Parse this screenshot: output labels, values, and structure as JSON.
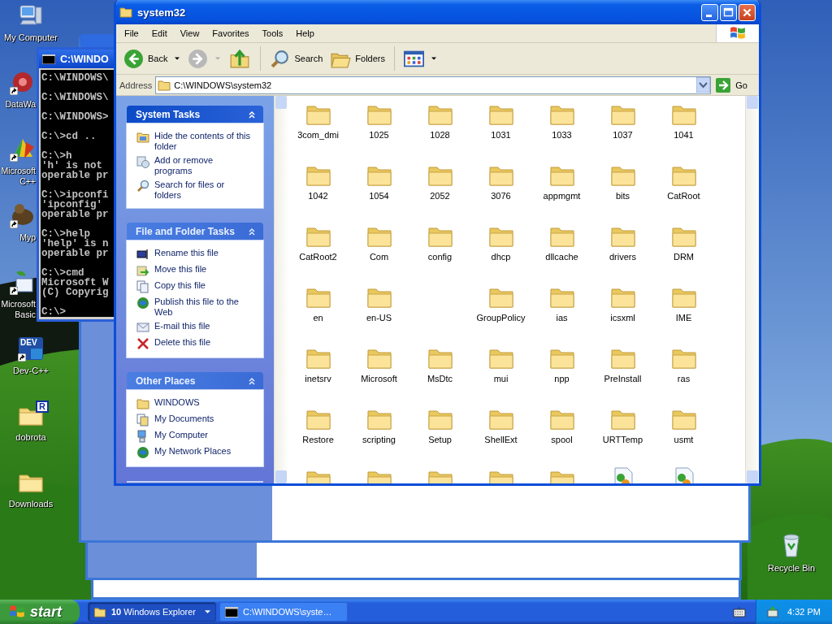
{
  "desktop": {
    "icons": [
      {
        "kind": "computer",
        "lines": [
          "My Computer"
        ],
        "shortcut": false
      },
      {
        "kind": "gear",
        "lines": [
          "DataWa"
        ],
        "shortcut": true
      },
      {
        "kind": "studio",
        "lines": [
          "Microsoft",
          "C++"
        ],
        "shortcut": true
      },
      {
        "kind": "creature",
        "lines": [
          "Myp"
        ],
        "shortcut": true
      },
      {
        "kind": "basic",
        "lines": [
          "Microsoft",
          "Basic"
        ],
        "shortcut": true
      },
      {
        "kind": "dev",
        "badge": "DEV",
        "lines": [
          "Dev-C++"
        ],
        "shortcut": true
      },
      {
        "kind": "folder",
        "badge": "R",
        "lines": [
          "dobrota"
        ],
        "shortcut": false
      },
      {
        "kind": "folder",
        "lines": [
          "Downloads"
        ],
        "shortcut": false
      }
    ],
    "recycle_bin": {
      "label": "Recycle Bin"
    }
  },
  "console_window": {
    "title": "C:\\WINDO",
    "blocks": [
      [
        "C:\\WINDOWS\\"
      ],
      [
        "C:\\WINDOWS\\"
      ],
      [
        "C:\\WINDOWS>"
      ],
      [
        "C:\\>cd .."
      ],
      [
        "C:\\>h",
        "'h' is not",
        "operable pr"
      ],
      [
        "C:\\>ipconfi",
        "'ipconfig'",
        "operable pr"
      ],
      [
        "C:\\>help",
        "'help' is n",
        "operable pr"
      ],
      [
        "C:\\>cmd",
        "Microsoft W",
        "(C) Copyrig"
      ],
      [
        "C:\\>"
      ]
    ]
  },
  "explorer": {
    "title": "system32",
    "menu": [
      "File",
      "Edit",
      "View",
      "Favorites",
      "Tools",
      "Help"
    ],
    "toolbar": {
      "back": "Back",
      "forward_disabled": true,
      "search": "Search",
      "folders": "Folders"
    },
    "address": {
      "label": "Address",
      "value": "C:\\WINDOWS\\system32",
      "go": "Go"
    },
    "task_panes": [
      {
        "title": "System Tasks",
        "special": true,
        "items": [
          {
            "kind": "hide",
            "label": "Hide the contents of this folder"
          },
          {
            "kind": "addremove",
            "label": "Add or remove programs"
          },
          {
            "kind": "search",
            "label": "Search for files or folders"
          }
        ]
      },
      {
        "title": "File and Folder Tasks",
        "special": false,
        "items": [
          {
            "kind": "rename",
            "label": "Rename this file"
          },
          {
            "kind": "move",
            "label": "Move this file"
          },
          {
            "kind": "copy",
            "label": "Copy this file"
          },
          {
            "kind": "publish",
            "label": "Publish this file to the Web"
          },
          {
            "kind": "email",
            "label": "E-mail this file"
          },
          {
            "kind": "delete",
            "label": "Delete this file"
          }
        ]
      },
      {
        "title": "Other Places",
        "special": false,
        "items": [
          {
            "kind": "folder",
            "label": "WINDOWS"
          },
          {
            "kind": "documents",
            "label": "My Documents"
          },
          {
            "kind": "computer",
            "label": "My Computer"
          },
          {
            "kind": "network",
            "label": "My Network Places"
          }
        ]
      }
    ],
    "items": [
      {
        "kind": "folder",
        "name": "3com_dmi"
      },
      {
        "kind": "folder",
        "name": "1025"
      },
      {
        "kind": "folder",
        "name": "1028"
      },
      {
        "kind": "folder",
        "name": "1031"
      },
      {
        "kind": "folder",
        "name": "1033"
      },
      {
        "kind": "folder",
        "name": "1037"
      },
      {
        "kind": "folder",
        "name": "1041"
      },
      {
        "kind": "folder",
        "name": "1042"
      },
      {
        "kind": "folder",
        "name": "1054"
      },
      {
        "kind": "folder",
        "name": "2052"
      },
      {
        "kind": "folder",
        "name": "3076"
      },
      {
        "kind": "folder",
        "name": "appmgmt"
      },
      {
        "kind": "folder",
        "name": "bits"
      },
      {
        "kind": "folder",
        "name": "CatRoot"
      },
      {
        "kind": "folder",
        "name": "CatRoot2"
      },
      {
        "kind": "folder",
        "name": "Com"
      },
      {
        "kind": "folder",
        "name": "config"
      },
      {
        "kind": "folder",
        "name": "dhcp"
      },
      {
        "kind": "folder",
        "name": "dllcache"
      },
      {
        "kind": "folder",
        "name": "drivers"
      },
      {
        "kind": "folder",
        "name": "DRM"
      },
      {
        "kind": "folder",
        "name": "en"
      },
      {
        "kind": "folder",
        "name": "en-US"
      },
      {
        "kind": "blank"
      },
      {
        "kind": "folder",
        "name": "GroupPolicy"
      },
      {
        "kind": "folder",
        "name": "ias"
      },
      {
        "kind": "folder",
        "name": "icsxml"
      },
      {
        "kind": "folder",
        "name": "IME"
      },
      {
        "kind": "folder",
        "name": "inetsrv"
      },
      {
        "kind": "folder",
        "name": "Microsoft"
      },
      {
        "kind": "folder",
        "name": "MsDtc"
      },
      {
        "kind": "folder",
        "name": "mui"
      },
      {
        "kind": "folder",
        "name": "npp"
      },
      {
        "kind": "folder",
        "name": "PreInstall"
      },
      {
        "kind": "folder",
        "name": "ras"
      },
      {
        "kind": "folder",
        "name": "Restore"
      },
      {
        "kind": "folder",
        "name": "scripting"
      },
      {
        "kind": "folder",
        "name": "Setup"
      },
      {
        "kind": "folder",
        "name": "ShellExt"
      },
      {
        "kind": "folder",
        "name": "spool"
      },
      {
        "kind": "folder",
        "name": "URTTemp"
      },
      {
        "kind": "folder",
        "name": "usmt"
      },
      {
        "kind": "folder"
      },
      {
        "kind": "folder"
      },
      {
        "kind": "folder"
      },
      {
        "kind": "folder"
      },
      {
        "kind": "folder"
      },
      {
        "kind": "file"
      },
      {
        "kind": "file"
      }
    ]
  },
  "taskbar": {
    "start": "start",
    "tasks": [
      {
        "kind": "explorer",
        "label": "**10** Windows Explorer",
        "selected": true
      },
      {
        "kind": "console",
        "label": "C:\\WINDOWS\\syste…",
        "selected": false
      }
    ],
    "clock": "4:32 PM"
  }
}
